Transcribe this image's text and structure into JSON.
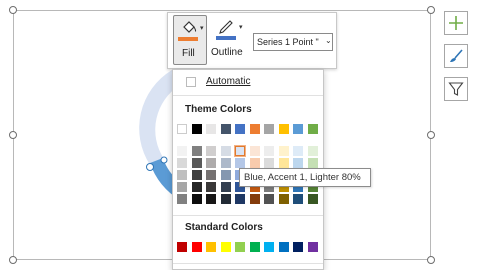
{
  "mini_toolbar": {
    "fill_label": "Fill",
    "outline_label": "Outline",
    "series_selector": "Series 1 Point \""
  },
  "fill_menu": {
    "automatic_label": "Automatic",
    "theme_colors_title": "Theme Colors",
    "standard_colors_title": "Standard Colors",
    "theme_colors": [
      "#ffffff",
      "#000000",
      "#e7e6e6",
      "#44546a",
      "#4472c4",
      "#ed7d31",
      "#a5a5a5",
      "#ffc000",
      "#5b9bd5",
      "#70ad47"
    ],
    "shade_columns": [
      [
        "#f2f2f2",
        "#d9d9d9",
        "#bfbfbf",
        "#a6a6a6",
        "#808080"
      ],
      [
        "#808080",
        "#595959",
        "#404040",
        "#262626",
        "#0d0d0d"
      ],
      [
        "#d0cece",
        "#aeabab",
        "#757171",
        "#3a3838",
        "#171616"
      ],
      [
        "#d6dce5",
        "#adb9ca",
        "#8497b0",
        "#333f50",
        "#222a35"
      ],
      [
        "#dae3f3",
        "#b4c7e7",
        "#8faadc",
        "#2f5597",
        "#1f3864"
      ],
      [
        "#fbe5d6",
        "#f8cbad",
        "#f4b183",
        "#c55a11",
        "#843c0c"
      ],
      [
        "#ededed",
        "#dbdbdb",
        "#c9c9c9",
        "#7b7b7b",
        "#525252"
      ],
      [
        "#fff2cc",
        "#ffe699",
        "#ffd966",
        "#bf9000",
        "#7f6000"
      ],
      [
        "#deebf7",
        "#bdd7ee",
        "#9dc3e6",
        "#2e75b6",
        "#1f4e79"
      ],
      [
        "#e2f0d9",
        "#c5e0b4",
        "#a9d18e",
        "#548235",
        "#385723"
      ]
    ],
    "standard_colors": [
      "#c00000",
      "#ff0000",
      "#ffc000",
      "#ffff00",
      "#92d050",
      "#00b050",
      "#00b0f0",
      "#0070c0",
      "#002060",
      "#7030a0"
    ],
    "highlighted_swatch": "Blue, Accent 1, Lighter 80%"
  },
  "tooltip": {
    "text": "Blue, Accent 1, Lighter 80%"
  },
  "chart": {
    "donut_light_color": "#dae3f3",
    "donut_accent_color": "#5b9bd5"
  },
  "side_buttons": [
    "plus-icon",
    "brush-icon",
    "filter-icon"
  ],
  "colors": {
    "fill_accent": "#ed7d31",
    "outline_accent": "#4472c4",
    "side_icon_plus": "#70ad47",
    "side_icon_brush": "#2e75b6"
  }
}
